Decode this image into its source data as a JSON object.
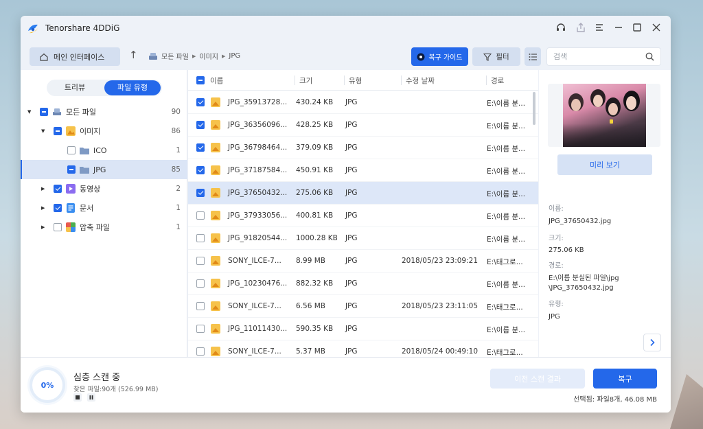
{
  "app": {
    "title": "Tenorshare 4DDiG"
  },
  "toolbar": {
    "home_label": "메인 인터페이스",
    "breadcrumb": [
      "모든 파일",
      "이미지",
      "JPG"
    ],
    "guide_label": "복구 가이드",
    "filter_label": "필터",
    "search_placeholder": "검색"
  },
  "sidebar": {
    "tabs": [
      "트리뷰",
      "파일 유형"
    ],
    "active_tab": "파일 유형",
    "tree": [
      {
        "label": "모든 파일",
        "count": "90"
      },
      {
        "label": "이미지",
        "count": "86"
      },
      {
        "label": "ICO",
        "count": "1"
      },
      {
        "label": "JPG",
        "count": "85"
      },
      {
        "label": "동영상",
        "count": "2"
      },
      {
        "label": "문서",
        "count": "1"
      },
      {
        "label": "압축 파일",
        "count": "1"
      }
    ]
  },
  "table": {
    "columns": [
      "이름",
      "크기",
      "유형",
      "수정 날짜",
      "경로"
    ],
    "rows": [
      {
        "name": "JPG_35913728...",
        "size": "430.24 KB",
        "type": "JPG",
        "date": "",
        "path": "E:\\이름 분...",
        "checked": true
      },
      {
        "name": "JPG_36356096...",
        "size": "428.25 KB",
        "type": "JPG",
        "date": "",
        "path": "E:\\이름 분...",
        "checked": true
      },
      {
        "name": "JPG_36798464...",
        "size": "379.09 KB",
        "type": "JPG",
        "date": "",
        "path": "E:\\이름 분...",
        "checked": true
      },
      {
        "name": "JPG_37187584...",
        "size": "450.91 KB",
        "type": "JPG",
        "date": "",
        "path": "E:\\이름 분...",
        "checked": true
      },
      {
        "name": "JPG_37650432...",
        "size": "275.06 KB",
        "type": "JPG",
        "date": "",
        "path": "E:\\이름 분...",
        "checked": true
      },
      {
        "name": "JPG_37933056...",
        "size": "400.81 KB",
        "type": "JPG",
        "date": "",
        "path": "E:\\이름 분...",
        "checked": false
      },
      {
        "name": "JPG_91820544...",
        "size": "1000.28 KB",
        "type": "JPG",
        "date": "",
        "path": "E:\\이름 분...",
        "checked": false
      },
      {
        "name": "SONY_ILCE-7...",
        "size": "8.99 MB",
        "type": "JPG",
        "date": "2018/05/23 23:09:21",
        "path": "E:\\태그로...",
        "checked": false
      },
      {
        "name": "JPG_10230476...",
        "size": "882.32 KB",
        "type": "JPG",
        "date": "",
        "path": "E:\\이름 분...",
        "checked": false
      },
      {
        "name": "SONY_ILCE-7...",
        "size": "6.56 MB",
        "type": "JPG",
        "date": "2018/05/23 23:11:05",
        "path": "E:\\태그로...",
        "checked": false
      },
      {
        "name": "JPG_11011430...",
        "size": "590.35 KB",
        "type": "JPG",
        "date": "",
        "path": "E:\\이름 분...",
        "checked": false
      },
      {
        "name": "SONY_ILCE-7...",
        "size": "5.37 MB",
        "type": "JPG",
        "date": "2018/05/24 00:49:10",
        "path": "E:\\태그로...",
        "checked": false
      }
    ]
  },
  "preview": {
    "button_label": "미리 보기",
    "name_label": "이름:",
    "name_value": "JPG_37650432.jpg",
    "size_label": "크기:",
    "size_value": "275.06 KB",
    "path_label": "경로:",
    "path_value_1": "E:\\이름 분실된 파일\\jpg",
    "path_value_2": "\\JPG_37650432.jpg",
    "type_label": "유형:",
    "type_value": "JPG"
  },
  "footer": {
    "progress_text": "0%",
    "progress": 0,
    "scan_title": "심층 스캔 중",
    "found_text": "찾은 파일:90개 (526.99 MB)",
    "prev_scan_label": "이전 스캔 결과",
    "recover_label": "복구",
    "selected_info": "선택됨: 파일8개, 46.08 MB"
  },
  "colors": {
    "accent": "#2468ea",
    "selected_row": "#dde7f8",
    "folder": "#7f9ac4"
  }
}
